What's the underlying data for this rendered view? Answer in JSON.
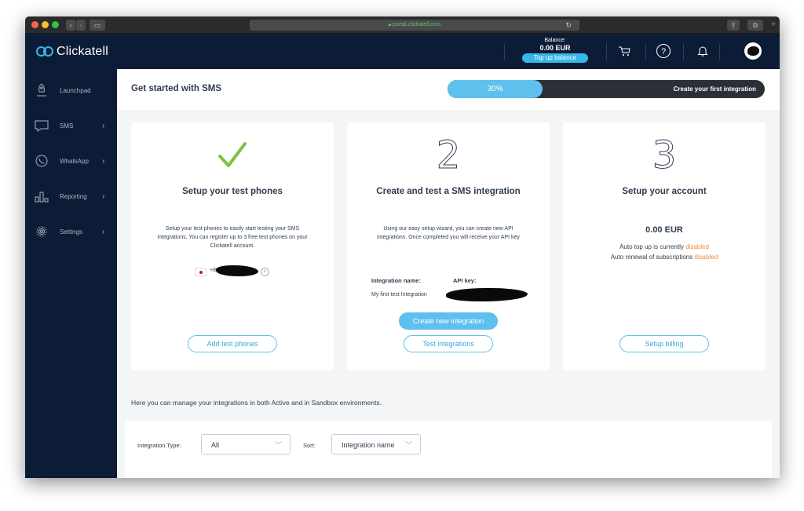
{
  "browser": {
    "url": "portal.clickatell.com"
  },
  "header": {
    "logo_text": "Clickatell",
    "balance_label": "Balance:",
    "balance_value": "0.00 EUR",
    "topup_label": "Top up balance"
  },
  "sidebar": {
    "items": [
      {
        "label": "Launchpad",
        "has_chevron": false
      },
      {
        "label": "SMS",
        "has_chevron": true
      },
      {
        "label": "WhatsApp",
        "has_chevron": true
      },
      {
        "label": "Reporting",
        "has_chevron": true
      },
      {
        "label": "Settings",
        "has_chevron": true
      }
    ]
  },
  "getting_started": {
    "title": "Get started with SMS",
    "progress_percent": 30,
    "progress_label": "30%",
    "next_step": "Create your first integration"
  },
  "cards": [
    {
      "title": "Setup your test phones",
      "description": "Setup your test phones to easily start testing your SMS integrations. You can register up to 3 free test phones on your Clickatell account.",
      "phone_prefix": "+8",
      "button": "Add test phones"
    },
    {
      "step_number": "2",
      "title": "Create and test a SMS integration",
      "description": "Using our easy setup wizard, you can create new API integrations. Once completed you will receive your API key",
      "integration_name_label": "Integration name:",
      "api_key_label": "API key:",
      "integration_name_value": "My first test Integration",
      "primary_button": "Create new integration",
      "secondary_button": "Test integrations"
    },
    {
      "step_number": "3",
      "title": "Setup your account",
      "amount": "0.00 EUR",
      "auto_topup_text": "Auto top up is currently",
      "auto_topup_status": "disabled",
      "auto_renewal_text": "Auto renewal of subscriptions",
      "auto_renewal_status": "disabled",
      "button": "Setup billing"
    }
  ],
  "manage_text": "Here you can manage your integrations in both Active and in Sandbox environments.",
  "filters": {
    "type_label": "Integration Type:",
    "type_value": "All",
    "sort_label": "Sort:",
    "sort_value": "Integration name"
  },
  "colors": {
    "nav_bg": "#0d1c36",
    "accent": "#5ec0ec",
    "warning": "#f08a3c",
    "check": "#7cc242"
  }
}
